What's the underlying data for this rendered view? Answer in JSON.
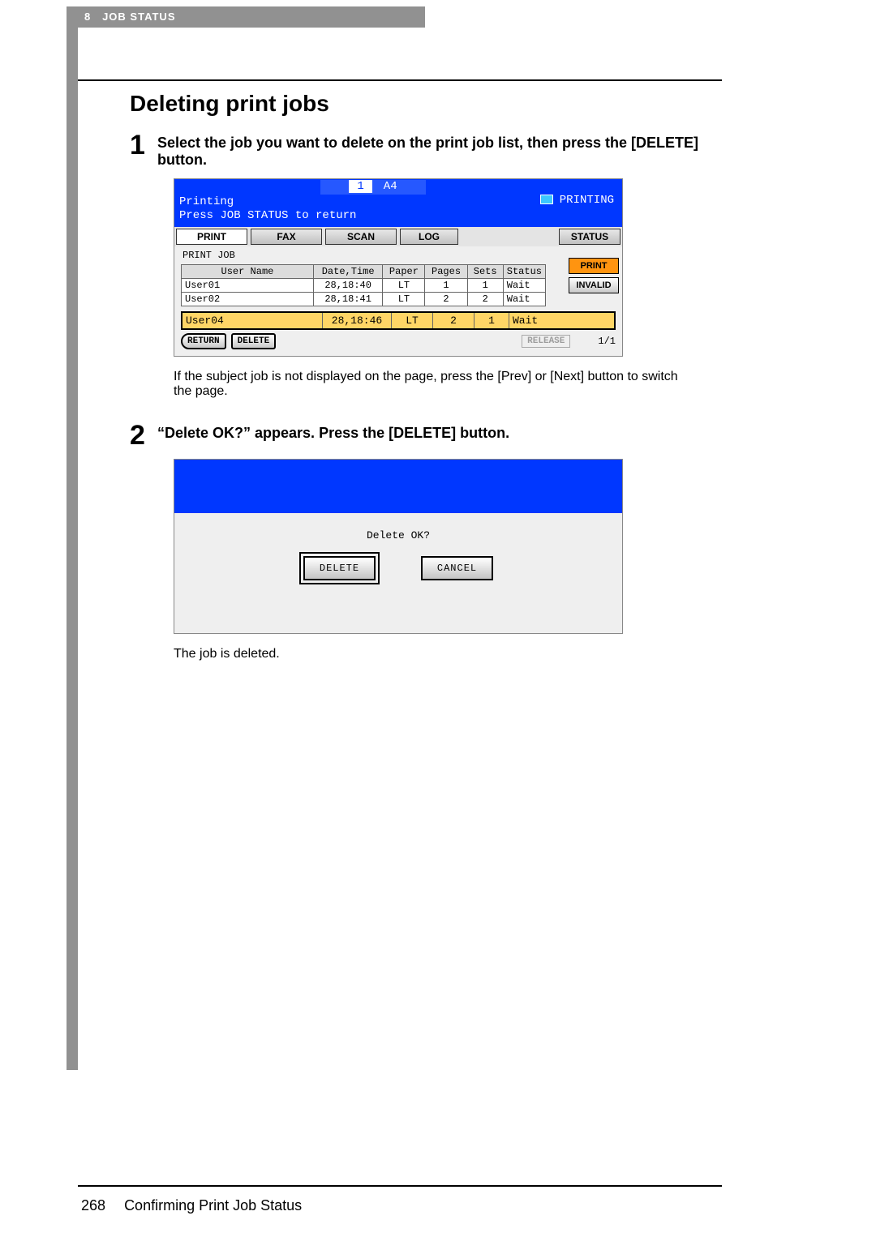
{
  "header": {
    "chapter": "8",
    "title": "JOB STATUS"
  },
  "section_title": "Deleting print jobs",
  "step1": {
    "num": "1",
    "text": "Select the job you want to delete on the print job list, then press the [DELETE] button."
  },
  "ss1": {
    "paper_num": "1",
    "paper_size": "A4",
    "status_left": "Printing",
    "hint": "Press JOB STATUS to return",
    "status_right": "PRINTING",
    "tabs": {
      "print": "PRINT",
      "fax": "FAX",
      "scan": "SCAN",
      "log": "LOG",
      "status": "STATUS"
    },
    "list_label": "PRINT JOB",
    "columns": {
      "user": "User Name",
      "dt": "Date,Time",
      "paper": "Paper",
      "pages": "Pages",
      "sets": "Sets",
      "status": "Status"
    },
    "rows": [
      {
        "user": "User01",
        "dt": "28,18:40",
        "paper": "LT",
        "pages": "1",
        "sets": "1",
        "status": "Wait"
      },
      {
        "user": "User02",
        "dt": "28,18:41",
        "paper": "LT",
        "pages": "2",
        "sets": "2",
        "status": "Wait"
      }
    ],
    "selected": {
      "user": "User04",
      "dt": "28,18:46",
      "paper": "LT",
      "pages": "2",
      "sets": "1",
      "status": "Wait"
    },
    "side": {
      "print": "PRINT",
      "invalid": "INVALID"
    },
    "footer": {
      "return": "RETURN",
      "delete": "DELETE",
      "release": "RELEASE",
      "pager": "1/1"
    }
  },
  "caption1": "If the subject job is not displayed on the page, press the [Prev] or [Next] button to switch the page.",
  "step2": {
    "num": "2",
    "text": "“Delete OK?” appears. Press the [DELETE] button."
  },
  "ss2": {
    "prompt": "Delete OK?",
    "delete": "DELETE",
    "cancel": "CANCEL"
  },
  "caption2": "The job is deleted.",
  "footer": {
    "page": "268",
    "title": "Confirming Print Job Status"
  }
}
